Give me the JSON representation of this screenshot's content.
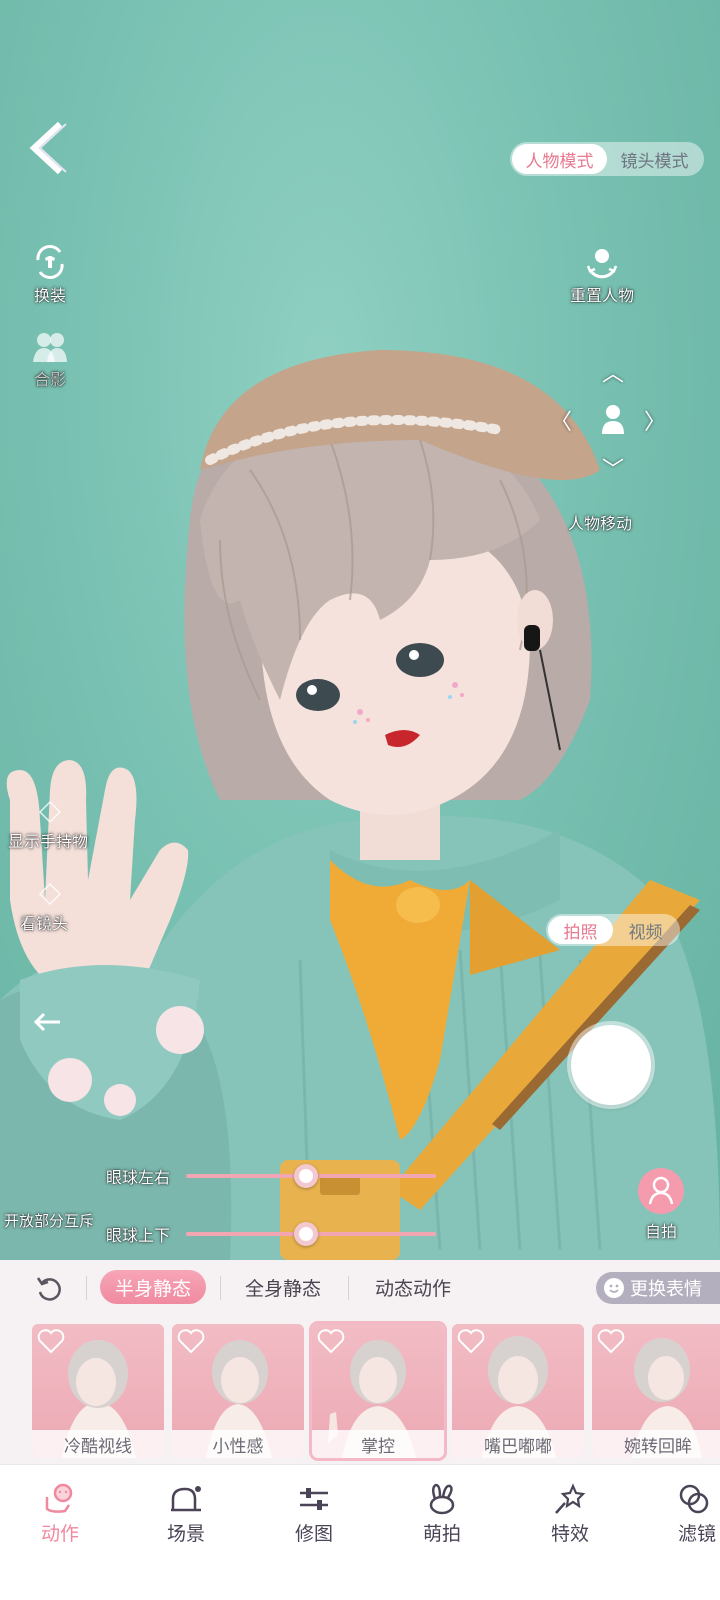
{
  "scene": {
    "mode_toggle": [
      "人物模式",
      "镜头模式"
    ],
    "mode_active": 0,
    "labels": {
      "outfit": "换装",
      "group_photo": "合影",
      "reset_character": "重置人物",
      "move_character": "人物移动",
      "show_handheld": "显示手持物",
      "look_camera": "看镜头",
      "open_part_interact": "开放部分互斥",
      "eye_horizontal": "眼球左右",
      "eye_vertical": "眼球上下",
      "selfie": "自拍"
    },
    "photo_toggle": [
      "拍照",
      "视频"
    ],
    "photo_active": 0,
    "eye_horizontal_value": 0.48,
    "eye_vertical_value": 0.48
  },
  "panel": {
    "tabs": [
      "半身静态",
      "全身静态",
      "动态动作"
    ],
    "active_tab": 0,
    "change_expression": "更换表情",
    "poses": [
      "冷酷视线",
      "小性感",
      "掌控",
      "嘴巴嘟嘟",
      "婉转回眸"
    ],
    "selected_pose": 2
  },
  "nav": {
    "items": [
      "动作",
      "场景",
      "修图",
      "萌拍",
      "特效",
      "滤镜"
    ],
    "active": 0
  },
  "colors": {
    "accent": "#f0889e",
    "backdrop": "#7ec4b6",
    "panel_bg": "#f6f2f3"
  }
}
